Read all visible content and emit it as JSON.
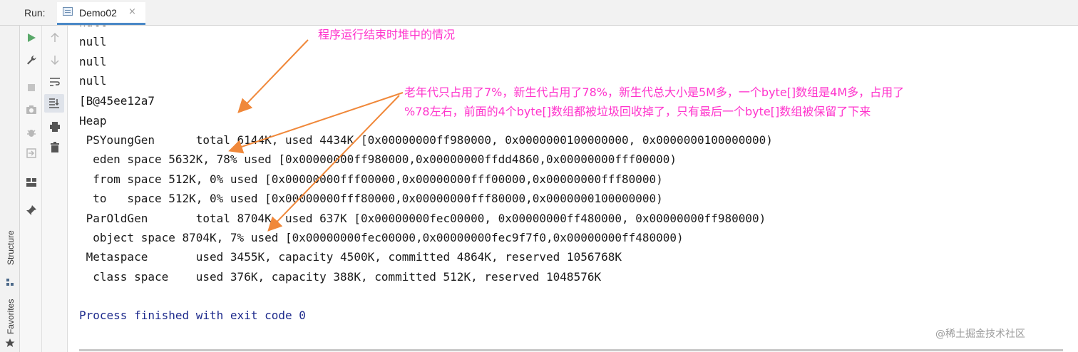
{
  "run_bar": {
    "label": "Run:",
    "tab_title": "Demo02",
    "tab_close": "×"
  },
  "side_stripe": {
    "structure": "Structure",
    "favorites": "Favorites"
  },
  "console": {
    "lines": [
      "null",
      "null",
      "null",
      "null",
      "[B@45ee12a7",
      "Heap",
      " PSYoungGen      total 6144K, used 4434K [0x00000000ff980000, 0x0000000100000000, 0x0000000100000000)",
      "  eden space 5632K, 78% used [0x00000000ff980000,0x00000000ffdd4860,0x00000000fff00000)",
      "  from space 512K, 0% used [0x00000000fff00000,0x00000000fff00000,0x00000000fff80000)",
      "  to   space 512K, 0% used [0x00000000fff80000,0x00000000fff80000,0x0000000100000000)",
      " ParOldGen       total 8704K, used 637K [0x00000000fec00000, 0x00000000ff480000, 0x00000000ff980000)",
      "  object space 8704K, 7% used [0x00000000fec00000,0x00000000fec9f7f0,0x00000000ff480000)",
      " Metaspace       used 3455K, capacity 4500K, committed 4864K, reserved 1056768K",
      "  class space    used 376K, capacity 388K, committed 512K, reserved 1048576K",
      "",
      "Process finished with exit code 0"
    ]
  },
  "annotations": {
    "title": "程序运行结束时堆中的情况",
    "note_line1": "老年代只占用了7%，新生代占用了78%，新生代总大小是5M多，一个byte[]数组是4M多，占用了",
    "note_line2": "%78左右，前面的4个byte[]数组都被垃圾回收掉了，只有最后一个byte[]数组被保留了下来"
  },
  "watermark": "@稀土掘金技术社区",
  "colors": {
    "annotation": "#ff33cc",
    "arrow": "#f0883a",
    "run_green": "#59a869",
    "exit_text": "#1d2a8c"
  }
}
